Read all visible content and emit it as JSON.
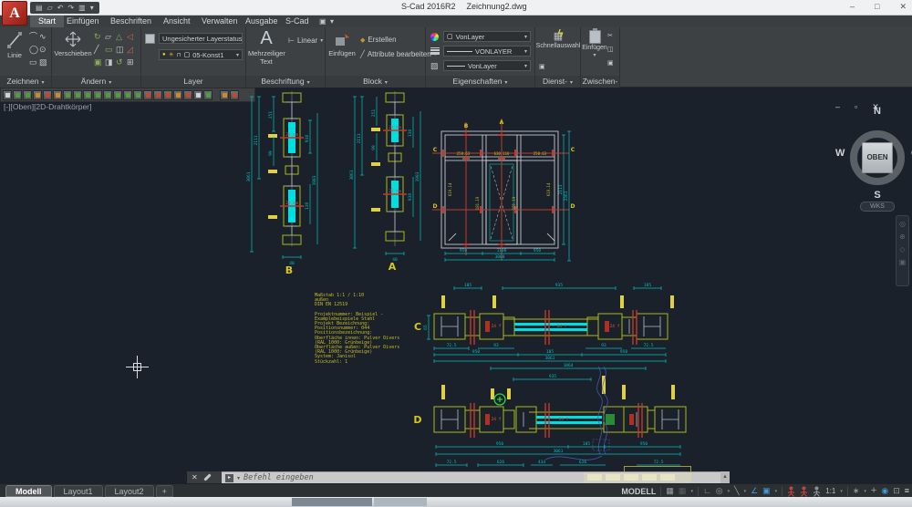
{
  "window": {
    "app_title": "S-Cad 2016R2",
    "doc_title": "Zeichnung2.dwg"
  },
  "icons": {
    "logo": "A",
    "new": "▤",
    "open": "▱",
    "undo": "↶",
    "redo": "↷",
    "print": "▥",
    "dropdown": "▾",
    "min": "–",
    "max": "□",
    "close": "✕",
    "restore": "▫",
    "tabbar_toggle": "▣",
    "draw_arc": "⌒",
    "draw_rev": "∿",
    "draw_circle": "◯",
    "draw_ellipse": "⊙",
    "draw_rect": "▭",
    "draw_hatch": "▨",
    "mod0": "↻",
    "mod1": "▱",
    "mod2": "△",
    "mod3": "◁",
    "mod4": "╱",
    "mod5": "▭",
    "mod6": "◫",
    "mod7": "◿",
    "mod8": "▣",
    "mod9": "◨",
    "mod10": "↺",
    "mod11": "⊞",
    "bulb": "●",
    "sun": "☀",
    "lock": "⊓",
    "swatch": "▢",
    "linear_dim": "⊢",
    "block_create": "◆",
    "block_attr": "╱",
    "cut": "✂",
    "copy": "◫",
    "flash": "ϟ",
    "cmd_close": "✕",
    "cmd_prompt": "▸",
    "scroll_up": "▲",
    "grid": "▦",
    "ortho": "∟",
    "polar": "◎",
    "iso": "╲",
    "angle": "∠",
    "osnap": "▣",
    "gear": "∗",
    "plus": "+",
    "clean_screen": "⊡",
    "menu": "≡",
    "circle_toggle": "◉",
    "nav_wheel": "◎",
    "nav_pan": "⊕",
    "nav_zoom": "◇",
    "nav_orbit": "▣"
  },
  "tabs": {
    "t0": "Start",
    "t1": "Einfügen",
    "t2": "Beschriften",
    "t3": "Ansicht",
    "t4": "Verwalten",
    "t5": "Ausgabe",
    "t6": "S-Cad"
  },
  "ribbon": {
    "zeichnen": {
      "label": "Zeichnen",
      "linie": "Linie"
    },
    "aendern": {
      "label": "Ändern",
      "verschieben": "Verschieben"
    },
    "layer": {
      "label": "Layer",
      "status": "Ungesicherter Layerstatus",
      "current": "05-Konst1"
    },
    "beschriftung": {
      "label": "Beschriftung",
      "mtext_icon": "A",
      "mtext": "Mehrzeiliger Text",
      "linear": "Linear"
    },
    "block": {
      "label": "Block",
      "einfuegen": "Einfügen",
      "erstellen": "Erstellen",
      "attribute": "Attribute bearbeiten"
    },
    "eigenschaften": {
      "label": "Eigenschaften",
      "color": "VonLayer",
      "lineweight": "VONLAYER",
      "linetype": "VonLayer"
    },
    "dienst": {
      "label": "Dienst-",
      "schnellauswahl": "Schnellauswahl"
    },
    "zwischen": {
      "label": "Zwischen-",
      "einfuegen": "Einfügen"
    }
  },
  "canvas": {
    "viewport_label": "[-][Oben][2D-Drahtkörper]",
    "viewcube": {
      "north": "N",
      "west": "W",
      "east": "O",
      "south": "S",
      "center": "OBEN",
      "wks": "WKS"
    }
  },
  "annotation": {
    "l0": "Maßstab 1:1 / 1:10",
    "l1": "außen",
    "l2": "DIN EN 12519",
    "l3": "Projektnummer: Beispiel - Examplebeispiele Stahl",
    "l4": "Projekt Bezeichnung:",
    "l5": "Positionsnummer: 044",
    "l6": "Positionsbezeichnung:",
    "l7": "Oberfläche innen: Pulver Divers",
    "l8": "(RAL 1000: Grünbeige)",
    "l9": "Oberfläche außen: Pulver Divers",
    "l10": "(RAL 1000: Grünbeige)",
    "l11": "System: Janisol",
    "l12": "Stückzahl: 1"
  },
  "sections": {
    "a": "A",
    "b": "B",
    "c": "C",
    "d": "D"
  },
  "dims": {
    "v_total": "3061",
    "v_outer": "2111",
    "v_seg1": "251",
    "v_seg2": "99",
    "v_seg3": "938",
    "v_seg4": "138",
    "v_right": "1983",
    "v_width": "40",
    "glass": "24 mm",
    "glass_f": "24 f",
    "e_b1": "950",
    "e_b2": "1100",
    "e_b3": "950",
    "e_total": "3000",
    "e_r1": "2111",
    "e_r2": "2361",
    "e_y1": "258.63",
    "e_y2": "630.116",
    "e_y3": "258.63",
    "e_y4": "619.14",
    "e_y5": "181.19",
    "c_t1": "185",
    "c_t2": "935",
    "c_t3": "185",
    "c_h": "65",
    "c_b1": "72.5",
    "c_b2": "93",
    "c_b3": "950",
    "c_b4": "185",
    "c_b5": "3061",
    "d_t1": "1064",
    "d_t2": "935",
    "d_b1": "950",
    "d_b2": "185",
    "d_b3": "3061",
    "d_b4": "72.5",
    "d_b5": "626",
    "d_b6": "434"
  },
  "command": {
    "prompt": "Befehl eingeben"
  },
  "layout_tabs": {
    "model": "Modell",
    "layout1": "Layout1",
    "layout2": "Layout2",
    "add": "+"
  },
  "status": {
    "model": "MODELL",
    "scale": "1:1"
  }
}
